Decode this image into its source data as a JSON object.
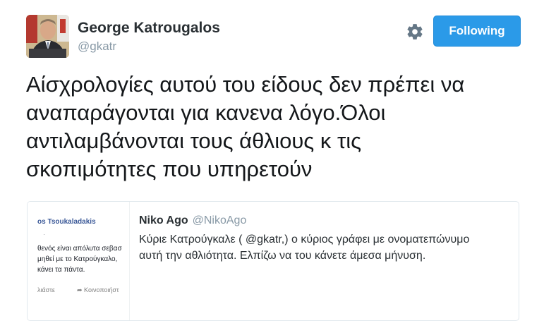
{
  "author": {
    "name": "George Katrougalos",
    "handle": "@gkatr"
  },
  "follow_button": {
    "label": "Following"
  },
  "icons": {
    "settings": "gear-icon"
  },
  "tweet": {
    "lines": [
      "Αίσχρολογίες αυτού του είδους δεν πρέπει να",
      "αναπαράγονται για κανενα λόγο.Όλοι",
      "αντιλαμβάνονται τους άθλιους κ τις",
      "σκοπιμότητες που υπηρετούν"
    ]
  },
  "quoted_tweet": {
    "name": "Niko Ago",
    "handle": "@NikoAgo",
    "lines": [
      "Κύριε Κατρούγκαλε ( @gkatr,) ο κύριος γράφει με ονοματεπώνυμο",
      "αυτή την αθλιότητα. Ελπίζω να του κάνετε άμεσα μήνυση."
    ],
    "thumbnail": {
      "name": "os Tsoukaladakis",
      "meta": "·",
      "lines": [
        "θενός είναι απόλυτα σεβασ",
        "μηθεί με το Κατρούγκαλο,",
        "κάνει τα πάντα."
      ],
      "action_like": "λιάστε",
      "action_share": "Κοινοποιήστ"
    }
  }
}
